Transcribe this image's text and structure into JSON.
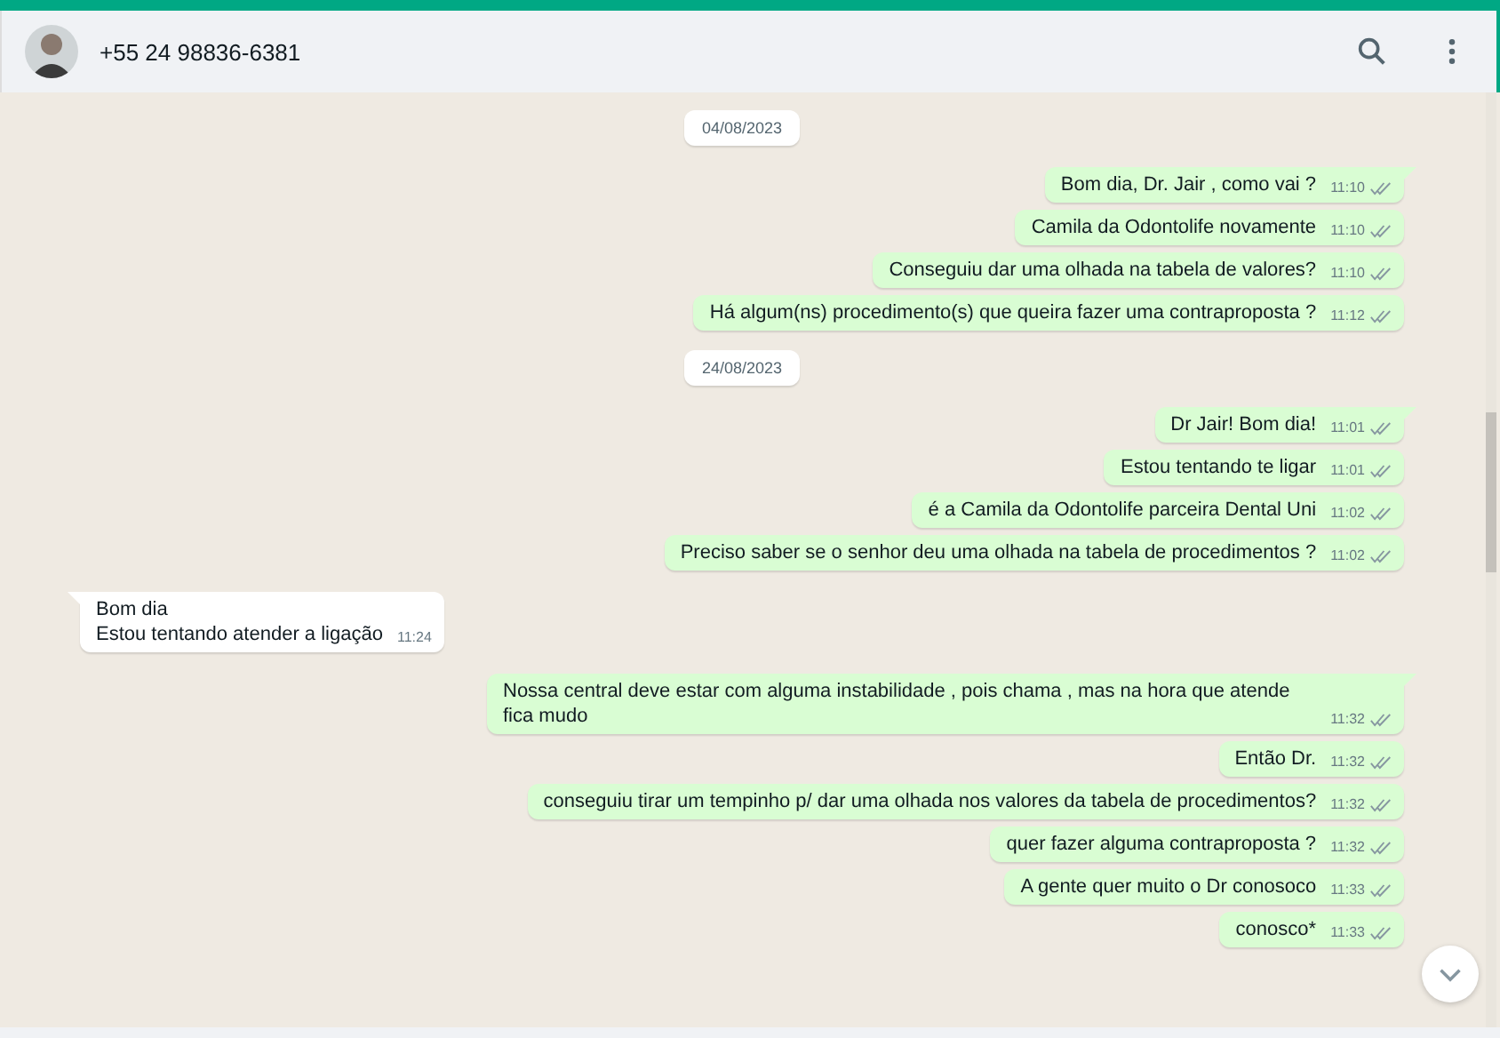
{
  "header": {
    "contact": "+55 24 98836-6381"
  },
  "messages": [
    {
      "kind": "date",
      "text": "04/08/2023"
    },
    {
      "kind": "out",
      "text": "Bom dia, Dr. Jair , como vai ?",
      "time": "11:10",
      "tail": true
    },
    {
      "kind": "out",
      "text": "Camila da Odontolife novamente",
      "time": "11:10",
      "tail": false
    },
    {
      "kind": "out",
      "text": "Conseguiu dar uma olhada na tabela de valores?",
      "time": "11:10",
      "tail": false
    },
    {
      "kind": "out",
      "text": "Há algum(ns) procedimento(s) que queira fazer uma contraproposta ?",
      "time": "11:12",
      "tail": false
    },
    {
      "kind": "date",
      "text": "24/08/2023"
    },
    {
      "kind": "out",
      "text": "Dr Jair! Bom dia!",
      "time": "11:01",
      "tail": true
    },
    {
      "kind": "out",
      "text": "Estou tentando te ligar",
      "time": "11:01",
      "tail": false
    },
    {
      "kind": "out",
      "text": "é a Camila da Odontolife parceira Dental Uni",
      "time": "11:02",
      "tail": false
    },
    {
      "kind": "out",
      "text": "Preciso saber se o senhor deu uma olhada na tabela de procedimentos ?",
      "time": "11:02",
      "tail": false
    },
    {
      "kind": "in",
      "text": "Bom dia\nEstou tentando atender a ligação",
      "time": "11:24",
      "tail": true
    },
    {
      "kind": "out",
      "text": "Nossa central deve estar com alguma instabilidade , pois chama , mas na hora que atende fica mudo",
      "time": "11:32",
      "tail": true
    },
    {
      "kind": "out",
      "text": "Então Dr.",
      "time": "11:32",
      "tail": false
    },
    {
      "kind": "out",
      "text": "conseguiu tirar um tempinho p/ dar uma olhada nos valores da tabela de procedimentos?",
      "time": "11:32",
      "tail": false
    },
    {
      "kind": "out",
      "text": "quer fazer alguma contraproposta ?",
      "time": "11:32",
      "tail": false
    },
    {
      "kind": "out",
      "text": "A gente quer muito o Dr conosoco",
      "time": "11:33",
      "tail": false
    },
    {
      "kind": "out",
      "text": "conosco*",
      "time": "11:33",
      "tail": false
    }
  ]
}
